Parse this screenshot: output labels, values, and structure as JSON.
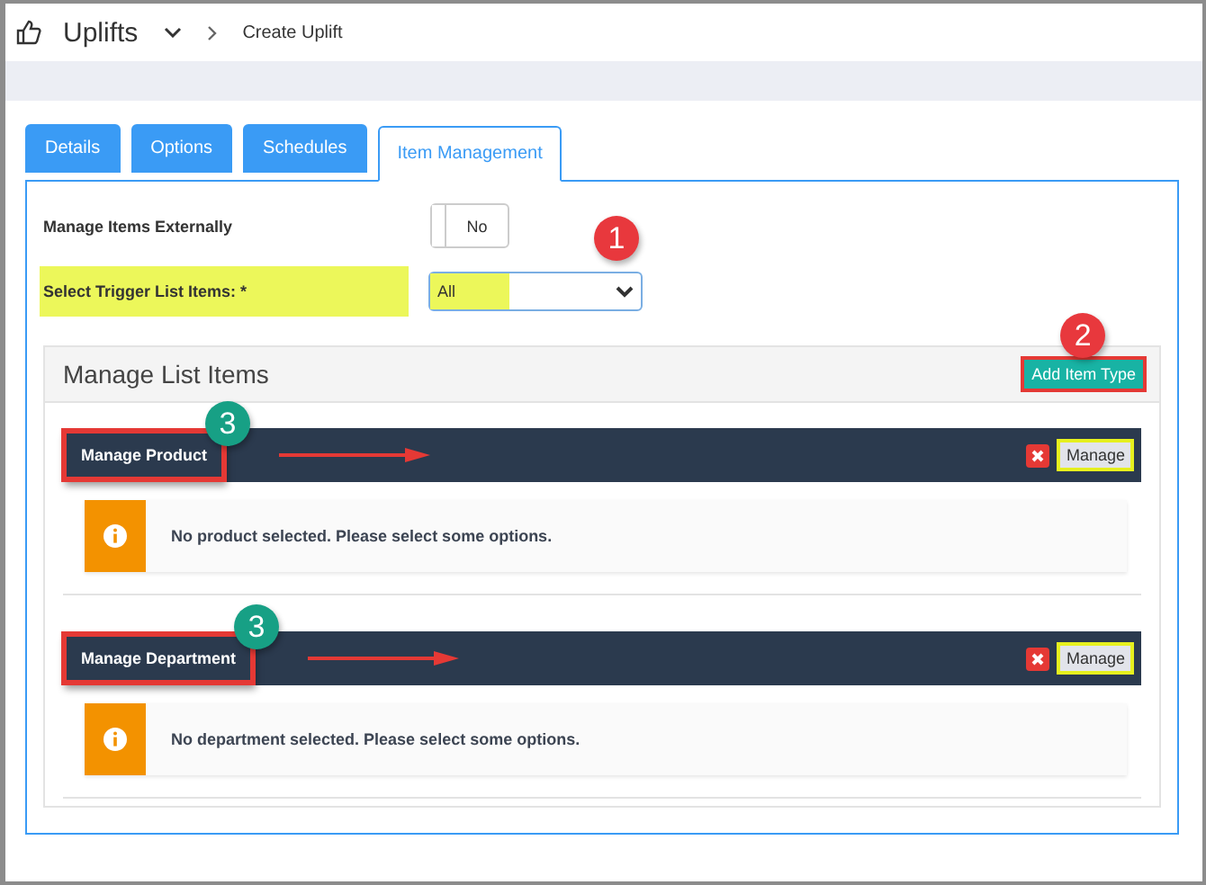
{
  "breadcrumb": {
    "title": "Uplifts",
    "page": "Create Uplift"
  },
  "tabs": [
    {
      "label": "Details",
      "selected": false
    },
    {
      "label": "Options",
      "selected": false
    },
    {
      "label": "Schedules",
      "selected": false
    },
    {
      "label": "Item Management",
      "selected": true
    }
  ],
  "fields": [
    {
      "kind": "toggle",
      "label": "Manage Items Externally",
      "value": "No",
      "on": false,
      "highlighted": false
    },
    {
      "kind": "select",
      "label": "Select Trigger List Items: *",
      "value": "All",
      "highlighted": true,
      "callout": {
        "number": "1",
        "color": "#e8383d"
      }
    }
  ],
  "list_panel": {
    "title": "Manage List Items",
    "add_button": {
      "label": "Add Item Type",
      "highlighted": true,
      "callout": {
        "number": "2",
        "color": "#e8383d"
      }
    },
    "groups": [
      {
        "title": "Manage Product",
        "highlighted": true,
        "callout": {
          "number": "3",
          "color": "#17a085"
        },
        "manage_button": "Manage",
        "manage_highlighted": true,
        "message": "No product selected. Please select some options."
      },
      {
        "title": "Manage Department",
        "highlighted": true,
        "callout": {
          "number": "3",
          "color": "#17a085"
        },
        "manage_button": "Manage",
        "manage_highlighted": true,
        "message": "No department selected. Please select some options."
      }
    ]
  }
}
